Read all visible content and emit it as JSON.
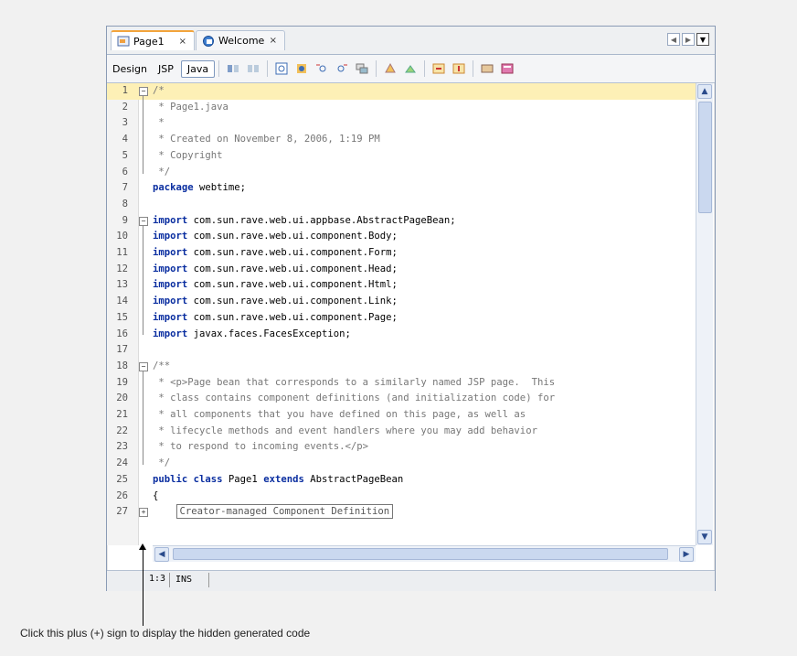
{
  "tabs": [
    {
      "label": "Page1",
      "close": "×",
      "active": true
    },
    {
      "label": "Welcome",
      "close": "×",
      "active": false
    }
  ],
  "toolbar": {
    "design_label": "Design",
    "jsp_label": "JSP",
    "java_label": "Java"
  },
  "editor": {
    "lines": [
      {
        "n": "1",
        "text": "/*"
      },
      {
        "n": "2",
        "text": " * Page1.java"
      },
      {
        "n": "3",
        "text": " *"
      },
      {
        "n": "4",
        "text": " * Created on November 8, 2006, 1:19 PM"
      },
      {
        "n": "5",
        "text": " * Copyright"
      },
      {
        "n": "6",
        "text": " */"
      },
      {
        "n": "7",
        "kw": "package",
        "text": " webtime;"
      },
      {
        "n": "8",
        "text": ""
      },
      {
        "n": "9",
        "kw": "import",
        "text": " com.sun.rave.web.ui.appbase.AbstractPageBean;"
      },
      {
        "n": "10",
        "kw": "import",
        "text": " com.sun.rave.web.ui.component.Body;"
      },
      {
        "n": "11",
        "kw": "import",
        "text": " com.sun.rave.web.ui.component.Form;"
      },
      {
        "n": "12",
        "kw": "import",
        "text": " com.sun.rave.web.ui.component.Head;"
      },
      {
        "n": "13",
        "kw": "import",
        "text": " com.sun.rave.web.ui.component.Html;"
      },
      {
        "n": "14",
        "kw": "import",
        "text": " com.sun.rave.web.ui.component.Link;"
      },
      {
        "n": "15",
        "kw": "import",
        "text": " com.sun.rave.web.ui.component.Page;"
      },
      {
        "n": "16",
        "kw": "import",
        "text": " javax.faces.FacesException;"
      },
      {
        "n": "17",
        "text": ""
      },
      {
        "n": "18",
        "text": "/**"
      },
      {
        "n": "19",
        "text": " * <p>Page bean that corresponds to a similarly named JSP page.  This"
      },
      {
        "n": "20",
        "text": " * class contains component definitions (and initialization code) for"
      },
      {
        "n": "21",
        "text": " * all components that you have defined on this page, as well as"
      },
      {
        "n": "22",
        "text": " * lifecycle methods and event handlers where you may add behavior"
      },
      {
        "n": "23",
        "text": " * to respond to incoming events.</p>"
      },
      {
        "n": "24",
        "text": " */"
      },
      {
        "n": "25",
        "kw": "public class",
        "text": " Page1 ",
        "kw2": "extends",
        "text2": " AbstractPageBean"
      },
      {
        "n": "26",
        "text": "{"
      },
      {
        "n": "27",
        "text": "    ",
        "folded": "Creator-managed Component Definition"
      }
    ]
  },
  "status": {
    "position": "1:3",
    "mode": "INS"
  },
  "caption": "Click this plus (+) sign to display the hidden generated code",
  "colors": {
    "keyword": "#0a2ea0",
    "comment": "#777777",
    "current_line": "#fdf0b6",
    "active_tab_accent": "#f2a43b"
  }
}
